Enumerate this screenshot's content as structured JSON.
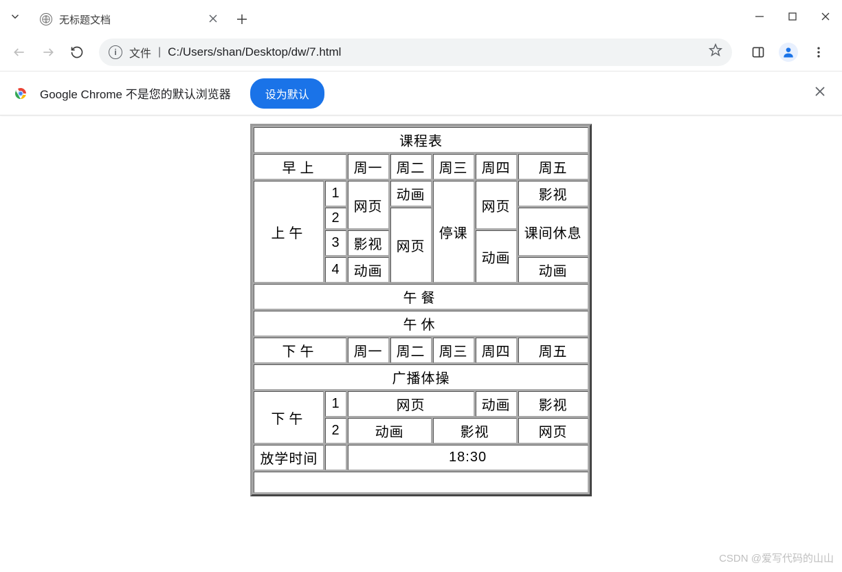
{
  "window": {
    "tab_title": "无标题文档"
  },
  "toolbar": {
    "file_label": "文件",
    "url": "C:/Users/shan/Desktop/dw/7.html"
  },
  "infobar": {
    "message": "Google Chrome 不是您的默认浏览器",
    "button": "设为默认"
  },
  "schedule": {
    "title": "课程表",
    "morning_label": "早上",
    "days": [
      "周一",
      "周二",
      "周三",
      "周四",
      "周五"
    ],
    "am_label": "上午",
    "periods": [
      "1",
      "2",
      "3",
      "4"
    ],
    "am": {
      "c1_mon_span2": "网页",
      "c1_tue": "动画",
      "c1_wed_span4": "停课",
      "c1_thu_span2": "网页",
      "c1_fri": "影视",
      "c2_fri_span2": "课间休息",
      "c2_tue_span3": "网页",
      "c3_mon": "影视",
      "c3_thu_span2": "动画",
      "c4_mon": "动画",
      "c4_fri": "动画"
    },
    "lunch": "午餐",
    "break": "午休",
    "pm_label": "下午",
    "gymnastics": "广播体操",
    "pm_label2": "下午",
    "pm_periods": [
      "1",
      "2"
    ],
    "pm": {
      "r1_a": "网页",
      "r1_b": "动画",
      "r1_c": "影视",
      "r2_a": "动画",
      "r2_b": "影视",
      "r2_c": "网页"
    },
    "dismiss_label": "放学时间",
    "dismiss_time": "18:30"
  },
  "watermark": "CSDN @爱写代码的山山"
}
